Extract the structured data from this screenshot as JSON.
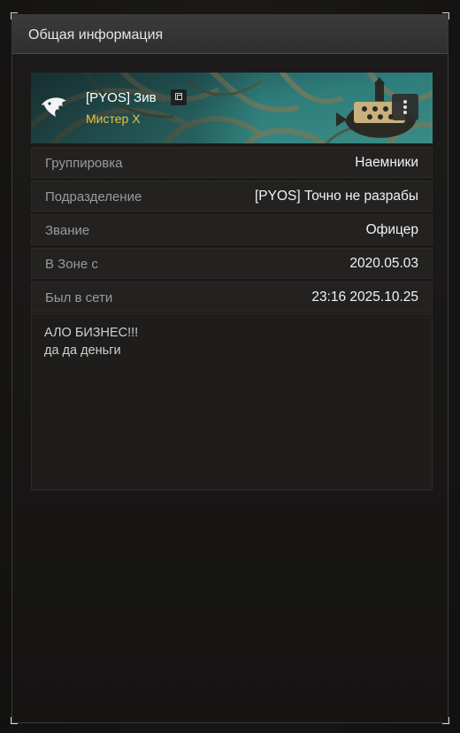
{
  "panel": {
    "title": "Общая информация"
  },
  "profile": {
    "name": "[PYOS] Зив",
    "title": "Мистер X",
    "title_color": "#e8c14a",
    "icons": {
      "avatar": "eagle-emblem-icon",
      "copy": "copy-icon",
      "menu": "more-vertical-icon"
    }
  },
  "info_rows": [
    {
      "label": "Группировка",
      "value": "Наемники"
    },
    {
      "label": "Подразделение",
      "value": "[PYOS] Точно не разрабы"
    },
    {
      "label": "Звание",
      "value": "Офицер"
    },
    {
      "label": "В Зоне с",
      "value": "2020.05.03"
    },
    {
      "label": "Был в сети",
      "value": "23:16 2025.10.25"
    }
  ],
  "note": {
    "lines": [
      "АЛО БИЗНЕС!!!",
      "да да деньги"
    ]
  }
}
